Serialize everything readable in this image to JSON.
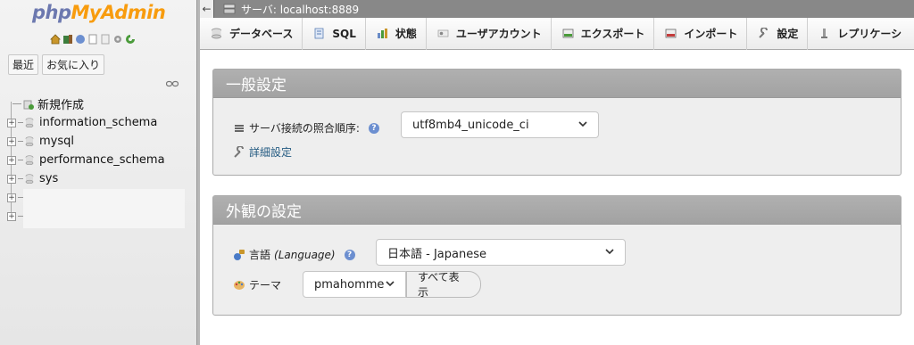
{
  "logo": {
    "php": "php",
    "admin": "MyAdmin"
  },
  "nav": {
    "tabs": [
      "最近",
      "お気に入り"
    ],
    "tree": [
      {
        "label": "新規作成",
        "type": "new"
      },
      {
        "label": "information_schema",
        "type": "db"
      },
      {
        "label": "mysql",
        "type": "db"
      },
      {
        "label": "performance_schema",
        "type": "db"
      },
      {
        "label": "sys",
        "type": "db"
      }
    ]
  },
  "serverbar": {
    "label": "サーバ: localhost:8889"
  },
  "menu": [
    {
      "label": "データベース",
      "icon": "database-icon"
    },
    {
      "label": "SQL",
      "icon": "sql-icon"
    },
    {
      "label": "状態",
      "icon": "status-icon"
    },
    {
      "label": "ユーザアカウント",
      "icon": "users-icon"
    },
    {
      "label": "エクスポート",
      "icon": "export-icon"
    },
    {
      "label": "インポート",
      "icon": "import-icon"
    },
    {
      "label": "設定",
      "icon": "wrench-icon"
    },
    {
      "label": "レプリケーシ",
      "icon": "replication-icon"
    }
  ],
  "general": {
    "title": "一般設定",
    "collation_label": "サーバ接続の照合順序:",
    "collation_value": "utf8mb4_unicode_ci",
    "more_settings": "詳細設定"
  },
  "appearance": {
    "title": "外観の設定",
    "language_label": "言語",
    "language_label_en": "(Language)",
    "language_value": "日本語 - Japanese",
    "theme_label": "テーマ",
    "theme_value": "pmahomme",
    "view_all": "すべて表示"
  },
  "colors": {
    "accent": "#235a81",
    "logo_php": "#6c78af",
    "logo_admin": "#f89c0e"
  }
}
